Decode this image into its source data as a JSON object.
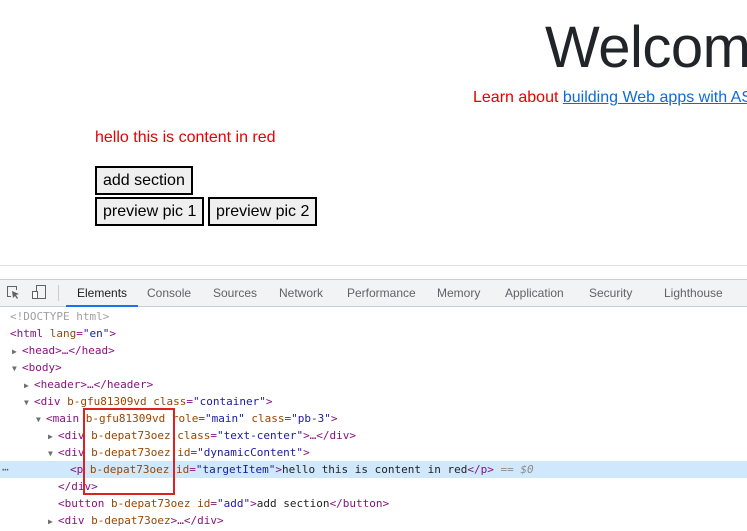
{
  "page": {
    "heading": "Welcome",
    "learn_prefix": "Learn about ",
    "learn_link": "building Web apps with ASP.NET Core",
    "red_content": "hello this is content in red",
    "buttons": {
      "add_section": "add section",
      "preview_pic_1": "preview pic 1",
      "preview_pic_2": "preview pic 2"
    }
  },
  "devtools": {
    "tabs": [
      {
        "label": "Elements",
        "active": true
      },
      {
        "label": "Console"
      },
      {
        "label": "Sources"
      },
      {
        "label": "Network"
      },
      {
        "label": "Performance"
      },
      {
        "label": "Memory"
      },
      {
        "label": "Application"
      },
      {
        "label": "Security"
      },
      {
        "label": "Lighthouse"
      }
    ],
    "tree": {
      "doctype": "<!DOCTYPE html>",
      "html_open": "<html",
      "html_attr": " lang",
      "html_val": "\"en\"",
      "head": "<head>…</head>",
      "body": "<body>",
      "header": "<header>…</header>",
      "div_container": {
        "tag": "<div",
        "attr1": " b-gfu81309vd",
        "attr2": " class",
        "val2": "\"container\"",
        "close": ">"
      },
      "main": {
        "tag": "<main",
        "attr1": " b-gfu81309vd",
        "attr2": " role",
        "val2": "\"main\"",
        "attr3": " class",
        "val3": "\"pb-3\"",
        "close": ">"
      },
      "div_text_center": {
        "tag": "<div",
        "attr1": " b-depat73oez",
        "attr2": " class",
        "val2": "\"text-center\"",
        "close": ">…</div>"
      },
      "div_dynamic": {
        "tag": "<div",
        "attr1": " b-depat73oez",
        "attr2": " id",
        "val2": "\"dynamicContent\"",
        "close": ">"
      },
      "p_target": {
        "tag": "<p",
        "attr1": " b-depat73oez",
        "attr2": " id",
        "val2": "\"targetItem\"",
        "close": ">",
        "text": "hello this is content in red",
        "end": "</p>",
        "eq": " == ",
        "dollar": "$0"
      },
      "div_close": "</div>",
      "button_add": {
        "tag": "<button",
        "attr1": " b-depat73oez",
        "attr2": " id",
        "val2": "\"add\"",
        "close": ">",
        "text": "add section",
        "end": "</button>"
      },
      "div_last": {
        "tag": "<div",
        "attr1": " b-depat73oez",
        "close": ">…</div>"
      }
    },
    "colors": {
      "tag": "#881280",
      "attr": "#994500",
      "value": "#1a1aa6",
      "selected_row": "#cfe8fc",
      "active_tab_underline": "#1a73e8",
      "highlight_box": "#e02020"
    }
  }
}
